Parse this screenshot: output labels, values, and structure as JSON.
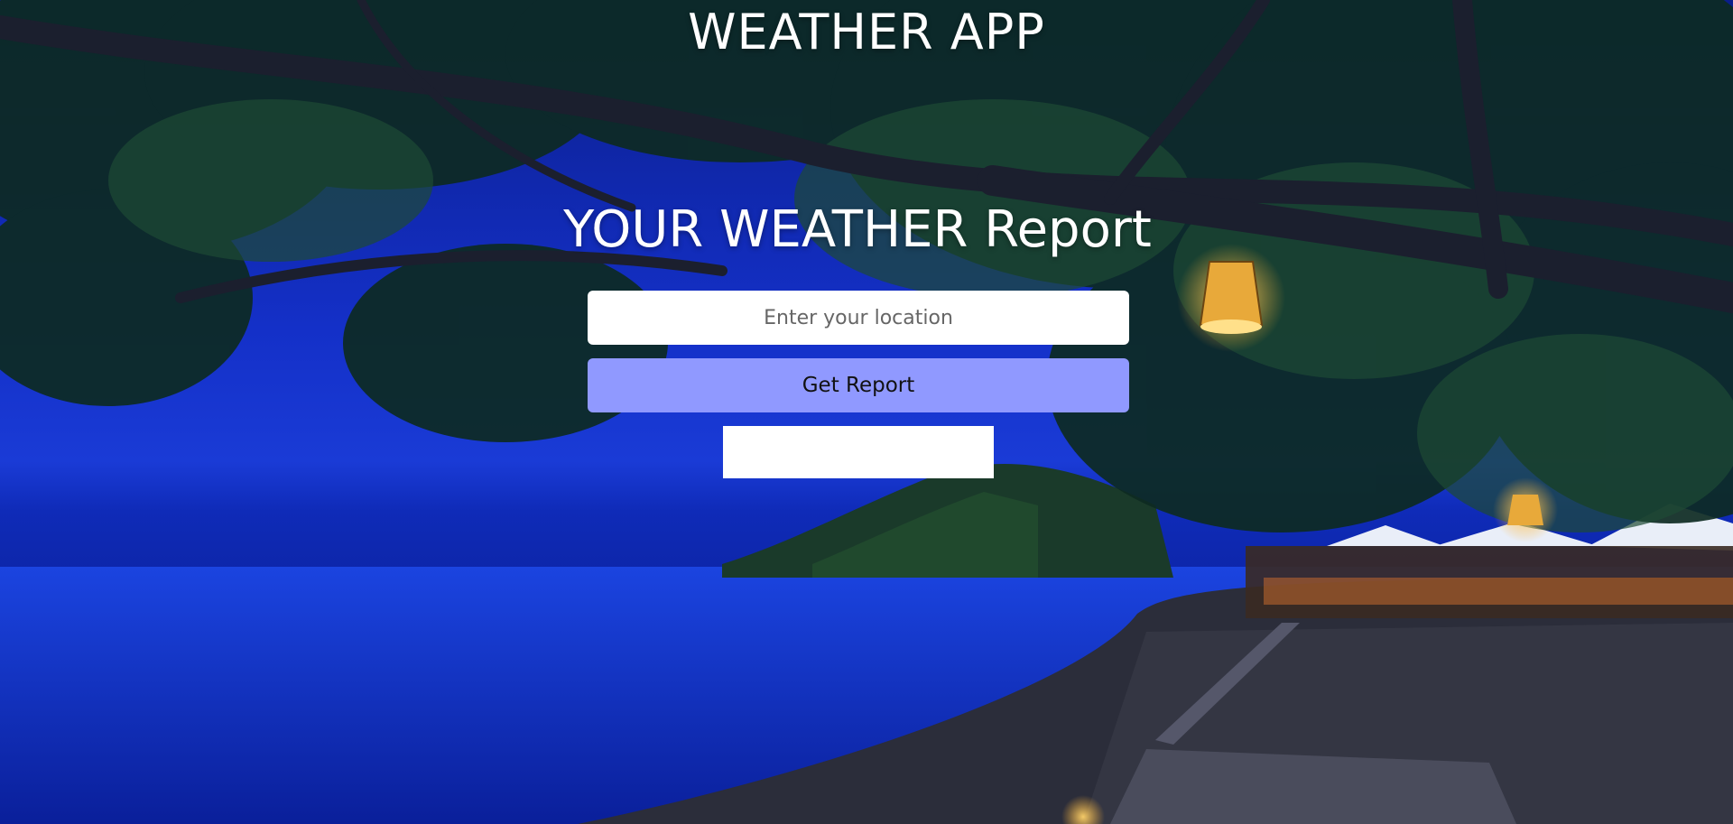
{
  "header": {
    "app_title": "WEATHER APP"
  },
  "main": {
    "heading": "YOUR WEATHER Report",
    "location_input": {
      "placeholder": "Enter your location",
      "value": ""
    },
    "get_report_label": "Get Report",
    "result": ""
  },
  "colors": {
    "button_background": "#9099ff",
    "heading_text": "#ffffff",
    "input_background": "#ffffff",
    "backdrop_primary": "#1a3bd6"
  },
  "background": {
    "scene": "night-beach-with-trees-and-lanterns"
  }
}
